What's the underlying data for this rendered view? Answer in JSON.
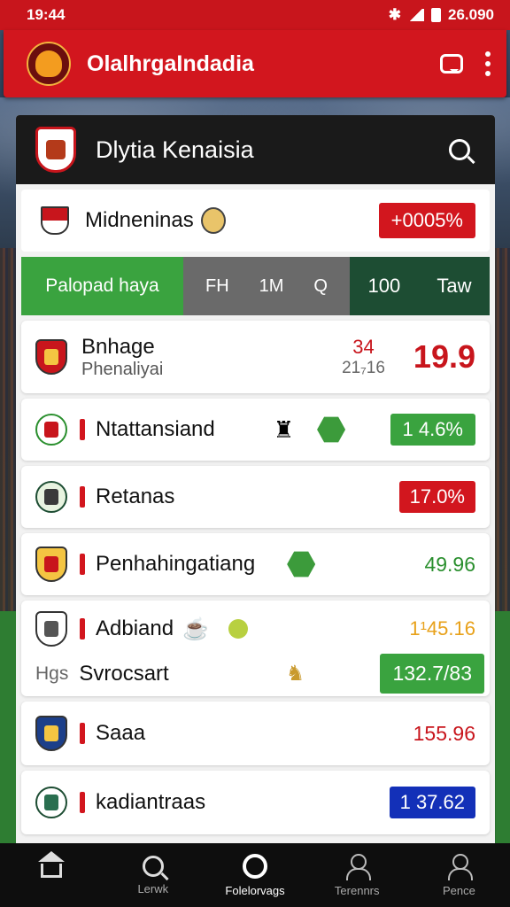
{
  "status_bar": {
    "time": "19:44",
    "battery_text": "26.090"
  },
  "app_bar": {
    "title": "OlalhrgaIndadia"
  },
  "panel": {
    "title": "Dlytia Kenaisia"
  },
  "featured": {
    "name": "Midneninas",
    "badge": "+0005%"
  },
  "tabs": {
    "main": "Palopad haya",
    "mid": [
      "FH",
      "1M",
      "Q"
    ],
    "right": [
      "100",
      "Taw"
    ]
  },
  "rows": [
    {
      "name": "Bnhage",
      "sub": "Phenaliyai",
      "top": "34",
      "bottom": "21₇16",
      "value": "19.9"
    },
    {
      "name": "Ntattansiand",
      "value": "1 4.6%"
    },
    {
      "name": "Retanas",
      "value": "17.0%"
    },
    {
      "name": "Penhahingatiang",
      "value": "49.96"
    },
    {
      "name": "Adbiand",
      "prefix": "Hgs",
      "sub_name": "Svrocsart",
      "value_top": "1¹45.16",
      "value_bottom": "132.7/83"
    },
    {
      "name": "Saaa",
      "value": "155.96"
    },
    {
      "name": "kadiantraas",
      "value": "1 37.62"
    }
  ],
  "bottom_nav": [
    "Lerwk",
    "Folelorvags",
    "Terennrs",
    "Pence"
  ],
  "colors": {
    "brand_red": "#d2161e",
    "green": "#3aa33f",
    "dark": "#1a1a1a",
    "blue": "#1330b8"
  }
}
